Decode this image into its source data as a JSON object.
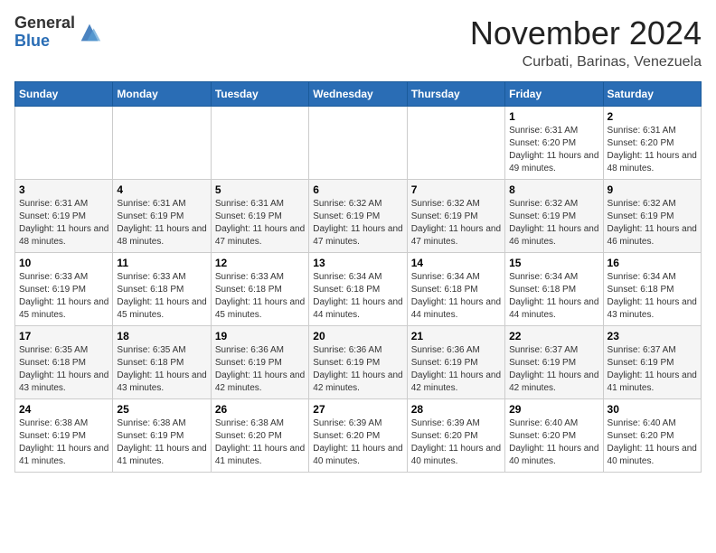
{
  "logo": {
    "general": "General",
    "blue": "Blue"
  },
  "header": {
    "month": "November 2024",
    "location": "Curbati, Barinas, Venezuela"
  },
  "weekdays": [
    "Sunday",
    "Monday",
    "Tuesday",
    "Wednesday",
    "Thursday",
    "Friday",
    "Saturday"
  ],
  "weeks": [
    [
      {
        "day": "",
        "info": ""
      },
      {
        "day": "",
        "info": ""
      },
      {
        "day": "",
        "info": ""
      },
      {
        "day": "",
        "info": ""
      },
      {
        "day": "",
        "info": ""
      },
      {
        "day": "1",
        "info": "Sunrise: 6:31 AM\nSunset: 6:20 PM\nDaylight: 11 hours and 49 minutes."
      },
      {
        "day": "2",
        "info": "Sunrise: 6:31 AM\nSunset: 6:20 PM\nDaylight: 11 hours and 48 minutes."
      }
    ],
    [
      {
        "day": "3",
        "info": "Sunrise: 6:31 AM\nSunset: 6:19 PM\nDaylight: 11 hours and 48 minutes."
      },
      {
        "day": "4",
        "info": "Sunrise: 6:31 AM\nSunset: 6:19 PM\nDaylight: 11 hours and 48 minutes."
      },
      {
        "day": "5",
        "info": "Sunrise: 6:31 AM\nSunset: 6:19 PM\nDaylight: 11 hours and 47 minutes."
      },
      {
        "day": "6",
        "info": "Sunrise: 6:32 AM\nSunset: 6:19 PM\nDaylight: 11 hours and 47 minutes."
      },
      {
        "day": "7",
        "info": "Sunrise: 6:32 AM\nSunset: 6:19 PM\nDaylight: 11 hours and 47 minutes."
      },
      {
        "day": "8",
        "info": "Sunrise: 6:32 AM\nSunset: 6:19 PM\nDaylight: 11 hours and 46 minutes."
      },
      {
        "day": "9",
        "info": "Sunrise: 6:32 AM\nSunset: 6:19 PM\nDaylight: 11 hours and 46 minutes."
      }
    ],
    [
      {
        "day": "10",
        "info": "Sunrise: 6:33 AM\nSunset: 6:19 PM\nDaylight: 11 hours and 45 minutes."
      },
      {
        "day": "11",
        "info": "Sunrise: 6:33 AM\nSunset: 6:18 PM\nDaylight: 11 hours and 45 minutes."
      },
      {
        "day": "12",
        "info": "Sunrise: 6:33 AM\nSunset: 6:18 PM\nDaylight: 11 hours and 45 minutes."
      },
      {
        "day": "13",
        "info": "Sunrise: 6:34 AM\nSunset: 6:18 PM\nDaylight: 11 hours and 44 minutes."
      },
      {
        "day": "14",
        "info": "Sunrise: 6:34 AM\nSunset: 6:18 PM\nDaylight: 11 hours and 44 minutes."
      },
      {
        "day": "15",
        "info": "Sunrise: 6:34 AM\nSunset: 6:18 PM\nDaylight: 11 hours and 44 minutes."
      },
      {
        "day": "16",
        "info": "Sunrise: 6:34 AM\nSunset: 6:18 PM\nDaylight: 11 hours and 43 minutes."
      }
    ],
    [
      {
        "day": "17",
        "info": "Sunrise: 6:35 AM\nSunset: 6:18 PM\nDaylight: 11 hours and 43 minutes."
      },
      {
        "day": "18",
        "info": "Sunrise: 6:35 AM\nSunset: 6:18 PM\nDaylight: 11 hours and 43 minutes."
      },
      {
        "day": "19",
        "info": "Sunrise: 6:36 AM\nSunset: 6:19 PM\nDaylight: 11 hours and 42 minutes."
      },
      {
        "day": "20",
        "info": "Sunrise: 6:36 AM\nSunset: 6:19 PM\nDaylight: 11 hours and 42 minutes."
      },
      {
        "day": "21",
        "info": "Sunrise: 6:36 AM\nSunset: 6:19 PM\nDaylight: 11 hours and 42 minutes."
      },
      {
        "day": "22",
        "info": "Sunrise: 6:37 AM\nSunset: 6:19 PM\nDaylight: 11 hours and 42 minutes."
      },
      {
        "day": "23",
        "info": "Sunrise: 6:37 AM\nSunset: 6:19 PM\nDaylight: 11 hours and 41 minutes."
      }
    ],
    [
      {
        "day": "24",
        "info": "Sunrise: 6:38 AM\nSunset: 6:19 PM\nDaylight: 11 hours and 41 minutes."
      },
      {
        "day": "25",
        "info": "Sunrise: 6:38 AM\nSunset: 6:19 PM\nDaylight: 11 hours and 41 minutes."
      },
      {
        "day": "26",
        "info": "Sunrise: 6:38 AM\nSunset: 6:20 PM\nDaylight: 11 hours and 41 minutes."
      },
      {
        "day": "27",
        "info": "Sunrise: 6:39 AM\nSunset: 6:20 PM\nDaylight: 11 hours and 40 minutes."
      },
      {
        "day": "28",
        "info": "Sunrise: 6:39 AM\nSunset: 6:20 PM\nDaylight: 11 hours and 40 minutes."
      },
      {
        "day": "29",
        "info": "Sunrise: 6:40 AM\nSunset: 6:20 PM\nDaylight: 11 hours and 40 minutes."
      },
      {
        "day": "30",
        "info": "Sunrise: 6:40 AM\nSunset: 6:20 PM\nDaylight: 11 hours and 40 minutes."
      }
    ]
  ]
}
